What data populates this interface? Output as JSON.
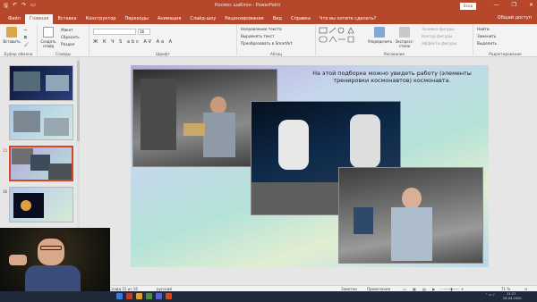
{
  "titlebar": {
    "title": "Космос шаблон - PowerPoint",
    "signin": "Вход",
    "window_buttons": [
      "—",
      "❐",
      "✕"
    ]
  },
  "tabs": [
    "Файл",
    "Главная",
    "Вставка",
    "Конструктор",
    "Переходы",
    "Анимация",
    "Слайд-шоу",
    "Рецензирование",
    "Вид",
    "Справка",
    "Что вы хотите сделать?"
  ],
  "share_label": "Общий доступ",
  "ribbon": {
    "paste": "Вставить",
    "cut": "✂",
    "clipboard": "Буфер обмена",
    "create_slide": "Создать слайд",
    "maket": "Макет",
    "reset": "Сбросить",
    "razdel": "Раздел",
    "slides": "Слайды",
    "font_name": "",
    "font_size": "16",
    "font_group": "Шрифт",
    "font_format": "Ж К Ч S abc AV Aa A",
    "text_dir": "Направление текста",
    "align_text": "Выровнять текст",
    "smartart": "Преобразовать в SmartArt",
    "paragraph": "Абзац",
    "arrange": "Упорядочить",
    "quick_styles": "Экспресс-стили",
    "shape_fill": "Заливка фигуры",
    "shape_outline": "Контур фигуры",
    "shape_effects": "Эффекты фигуры",
    "drawing": "Рисование",
    "find": "Найти",
    "replace": "Заменить",
    "select": "Выделить",
    "editing": "Редактирование"
  },
  "slides_panel": {
    "numbers": [
      "",
      "",
      "15",
      "16"
    ]
  },
  "slide": {
    "text": "На этой подборке можно увидеть работу (элементы тренировки космонавтов) космонавта."
  },
  "statusbar": {
    "slide_info": "Слайд 15 из 16",
    "language": "русский",
    "notes": "Заметки",
    "comments": "Примечания",
    "zoom": "71 %"
  },
  "taskbar": {
    "time": "11:27",
    "date": "26.04.2020"
  },
  "colors": {
    "accent": "#b7472a",
    "selected_thumb_border": "#d24726"
  }
}
